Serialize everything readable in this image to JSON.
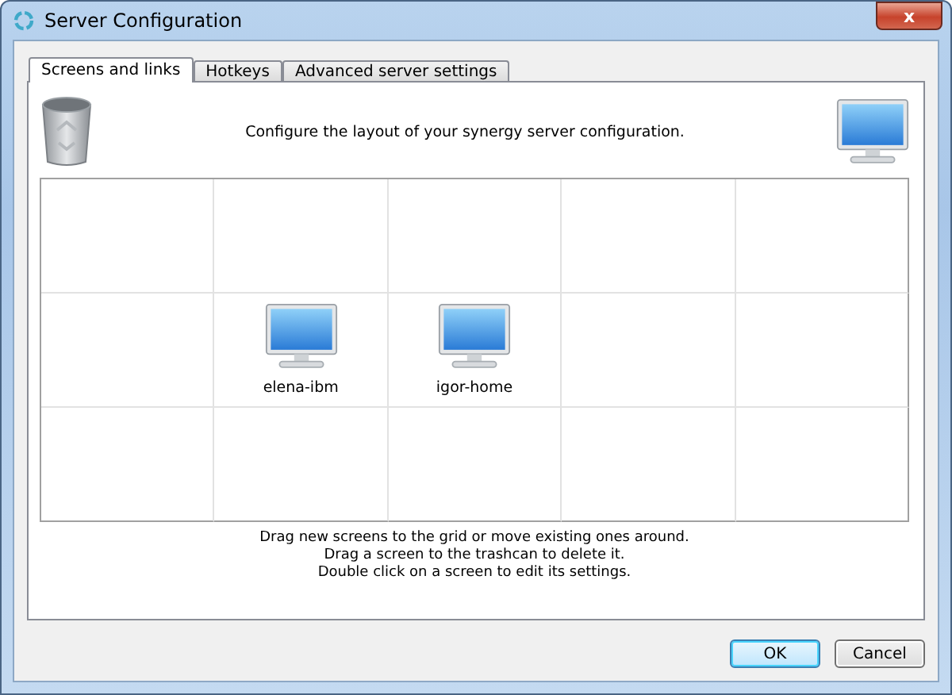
{
  "window": {
    "title": "Server Configuration",
    "close": "x"
  },
  "tabs": [
    {
      "label": "Screens and links",
      "selected": true
    },
    {
      "label": "Hotkeys",
      "selected": false
    },
    {
      "label": "Advanced server settings",
      "selected": false
    }
  ],
  "header": {
    "text": "Configure the layout of your synergy server configuration."
  },
  "grid": {
    "rows": [
      [
        {
          "kind": "empty"
        },
        {
          "kind": "empty"
        },
        {
          "kind": "empty"
        },
        {
          "kind": "empty"
        },
        {
          "kind": "empty"
        }
      ],
      [
        {
          "kind": "empty"
        },
        {
          "kind": "screen",
          "label": "elena-ibm"
        },
        {
          "kind": "screen",
          "label": "igor-home"
        },
        {
          "kind": "empty"
        },
        {
          "kind": "empty"
        }
      ],
      [
        {
          "kind": "empty"
        },
        {
          "kind": "empty"
        },
        {
          "kind": "empty"
        },
        {
          "kind": "empty"
        },
        {
          "kind": "empty"
        }
      ]
    ]
  },
  "hints": [
    "Drag new screens to the grid or move existing ones around.",
    "Drag a screen to the trashcan to delete it.",
    "Double click on a screen to edit its settings."
  ],
  "buttons": [
    {
      "label": "OK",
      "default": true
    },
    {
      "label": "Cancel",
      "default": false
    }
  ]
}
